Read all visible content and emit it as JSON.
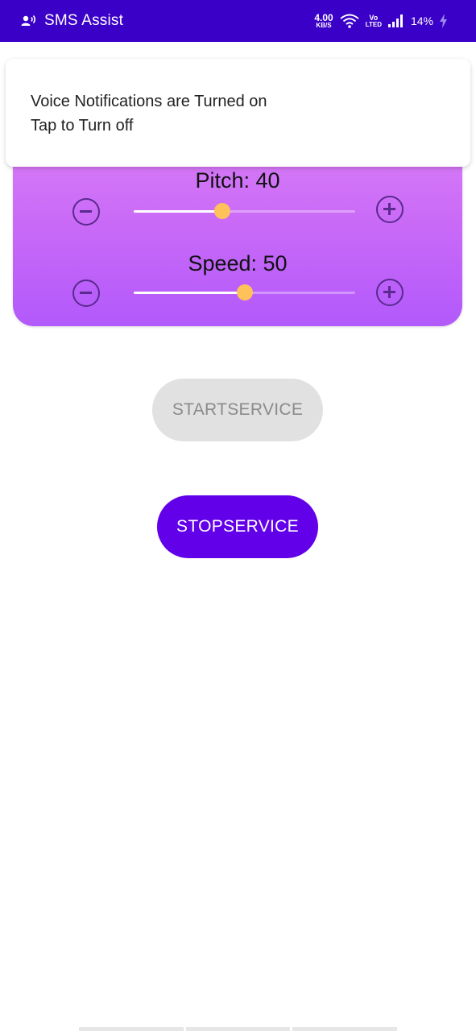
{
  "status_bar": {
    "app_title": "SMS Assist",
    "app_icon": "voice-notification-icon",
    "net_speed_value": "4.00",
    "net_speed_unit": "KB/S",
    "volte_top": "Vo",
    "volte_bottom": "LTED",
    "battery": "14%",
    "bg_color": "#3a00c8"
  },
  "notification": {
    "line1": "Voice Notifications are Turned on",
    "line2": "Tap to Turn off"
  },
  "controls": {
    "pitch": {
      "label": "Pitch: 40",
      "value": 40,
      "max": 100
    },
    "speed": {
      "label": "Speed: 50",
      "value": 50,
      "max": 100
    },
    "minus_icon": "minus-circle-icon",
    "plus_icon": "plus-circle-icon",
    "thumb_color": "#ffc15a"
  },
  "buttons": {
    "start": "STARTSERVICE",
    "stop": "STOPSERVICE",
    "stop_color": "#6200ea"
  }
}
